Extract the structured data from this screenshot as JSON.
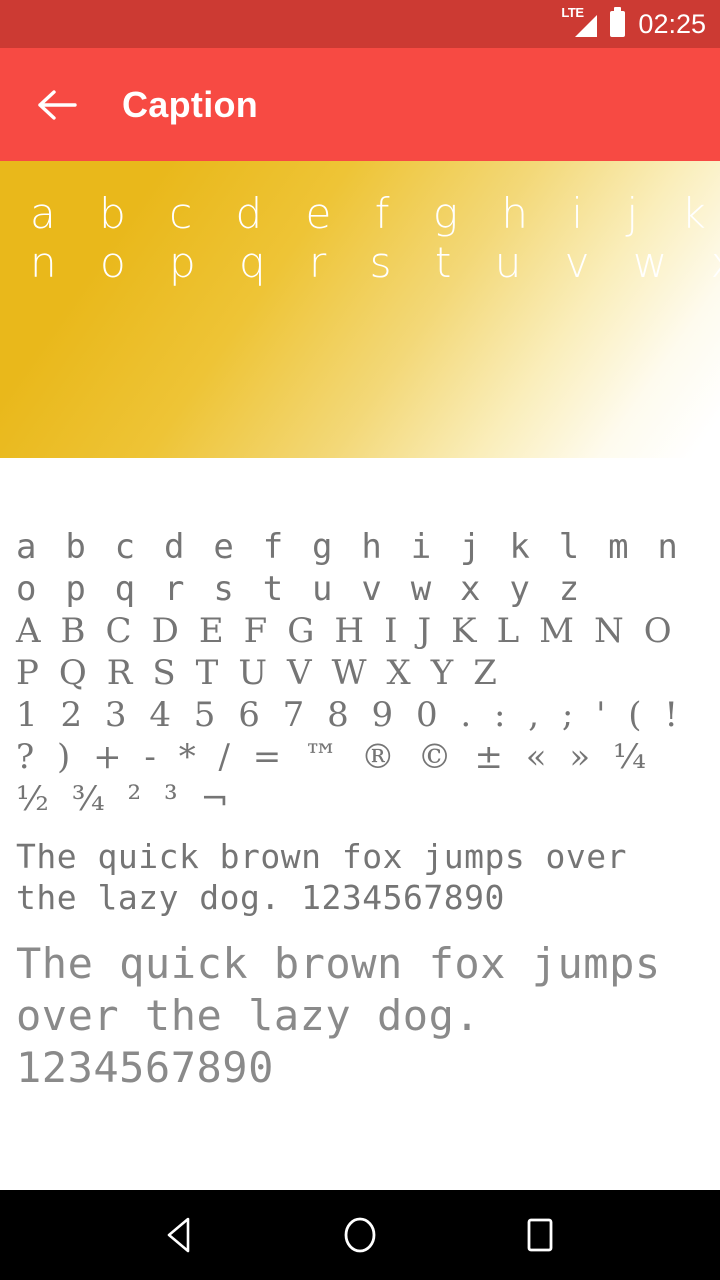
{
  "status_bar": {
    "network_label": "LTE",
    "network_icon": "signal-triangle-icon",
    "battery_icon": "battery-full-icon",
    "time": "02:25",
    "background_color": "#cc3a33",
    "foreground_color": "#ffffff"
  },
  "app_bar": {
    "back_icon": "arrow-left-icon",
    "title": "Caption",
    "background_color": "#f74a43",
    "text_color": "#ffffff"
  },
  "preview_banner": {
    "line1": "a b c d e f g h i j k l m",
    "line2": "n o p q r s t u v w x y z",
    "text_color": "#ffffff",
    "gradient_start_color": "#e9b81b",
    "gradient_end_color": "#ffffff"
  },
  "sample_sheet": {
    "text_color": "#757575",
    "lowercase_glyphs": "a b c d e f g h i j k l m n o p q r s t u v w x y z",
    "uppercase_glyphs": "A B C D E F G H I J K L M N O P Q R S T U V W X Y Z",
    "digits_and_symbols": "1 2 3 4 5 6 7 8 9 0 . : , ; ' ( ! ? ) + - * / = ™ ® © ± « » ¼ ½ ¾ ² ³ ¬",
    "pangram_small": "The quick brown fox jumps over the lazy dog. 1234567890",
    "pangram_large": "The quick brown fox jumps over the lazy dog. 1234567890"
  },
  "nav_bar": {
    "back_icon": "nav-back-triangle-icon",
    "home_icon": "nav-home-circle-icon",
    "recents_icon": "nav-recents-square-icon",
    "background_color": "#000000"
  }
}
